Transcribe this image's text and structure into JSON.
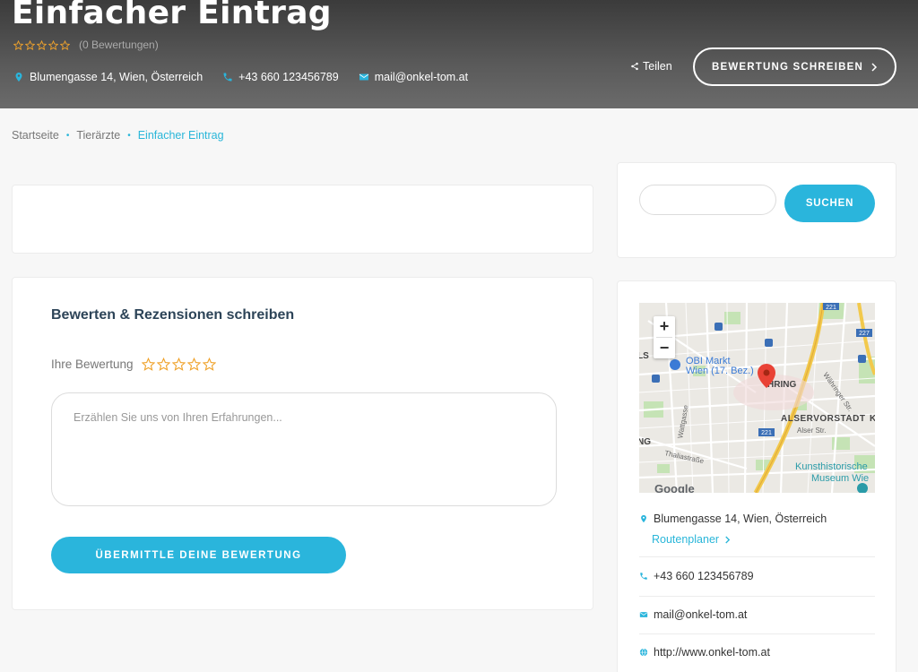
{
  "hero": {
    "title": "Einfacher Eintrag",
    "rating_count": "(0 Bewertungen)",
    "address": "Blumengasse 14, Wien, Österreich",
    "phone": "+43 660 123456789",
    "email": "mail@onkel-tom.at",
    "share_label": "Teilen",
    "write_review_label": "BEWERTUNG SCHREIBEN"
  },
  "breadcrumb": {
    "items": [
      "Startseite",
      "Tierärzte",
      "Einfacher Eintrag"
    ]
  },
  "review": {
    "title": "Bewerten & Rezensionen schreiben",
    "your_rating_label": "Ihre Bewertung",
    "textarea_placeholder": "Erzählen Sie uns von Ihren Erfahrungen...",
    "submit_label": "ÜBERMITTLE DEINE BEWERTUNG"
  },
  "search": {
    "placeholder": "",
    "button_label": "SUCHEN"
  },
  "map": {
    "labels": {
      "obi": "OBI Markt",
      "obi2": "Wien (17. Bez.)",
      "hring": "HRING",
      "alservorstadt": "ALSERVORSTADT",
      "alservorstadt_k": "K",
      "khm1": "Kunsthistorische",
      "khm2": "Museum Wie",
      "wattgasse": "Wattgasse",
      "thaliastrasse": "Thaliastraße",
      "waehringer": "Währinger Str.",
      "alser": "Alser Str.",
      "route221": "221",
      "route227": "227",
      "google": "Google",
      "edge_ls": "LS",
      "edge_ng": "NG"
    },
    "zoom_in": "+",
    "zoom_out": "−"
  },
  "sidebar_info": {
    "address": "Blumengasse 14, Wien, Österreich",
    "route_label": "Routenplaner",
    "phone": "+43 660 123456789",
    "email": "mail@onkel-tom.at",
    "website": "http://www.onkel-tom.at"
  },
  "colors": {
    "accent": "#2ab5dc",
    "heading": "#2d4458",
    "star": "#f0a32c"
  }
}
